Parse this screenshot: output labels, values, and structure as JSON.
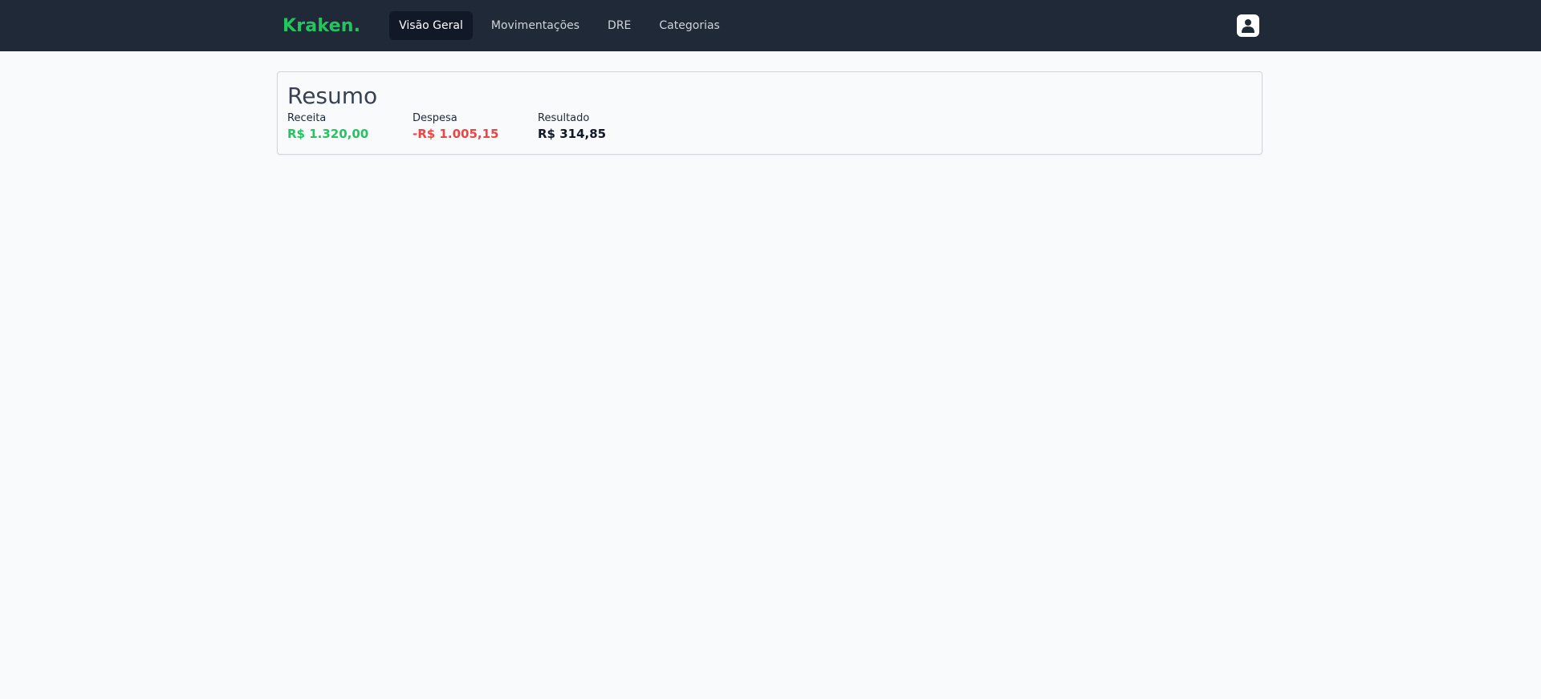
{
  "brand": {
    "name": "Kraken."
  },
  "nav": {
    "items": [
      {
        "label": "Visão Geral",
        "active": true
      },
      {
        "label": "Movimentações",
        "active": false
      },
      {
        "label": "DRE",
        "active": false
      },
      {
        "label": "Categorias",
        "active": false
      }
    ],
    "user_icon": "user-icon"
  },
  "summary": {
    "title": "Resumo",
    "receita": {
      "label": "Receita",
      "value": "R$ 1.320,00"
    },
    "despesa": {
      "label": "Despesa",
      "value": "-R$ 1.005,15"
    },
    "resultado": {
      "label": "Resultado",
      "value": "R$ 314,85"
    }
  },
  "colors": {
    "navbar_bg": "#1f2937",
    "brand": "#22c55e",
    "positive": "#22c55e",
    "negative": "#ef4444"
  }
}
